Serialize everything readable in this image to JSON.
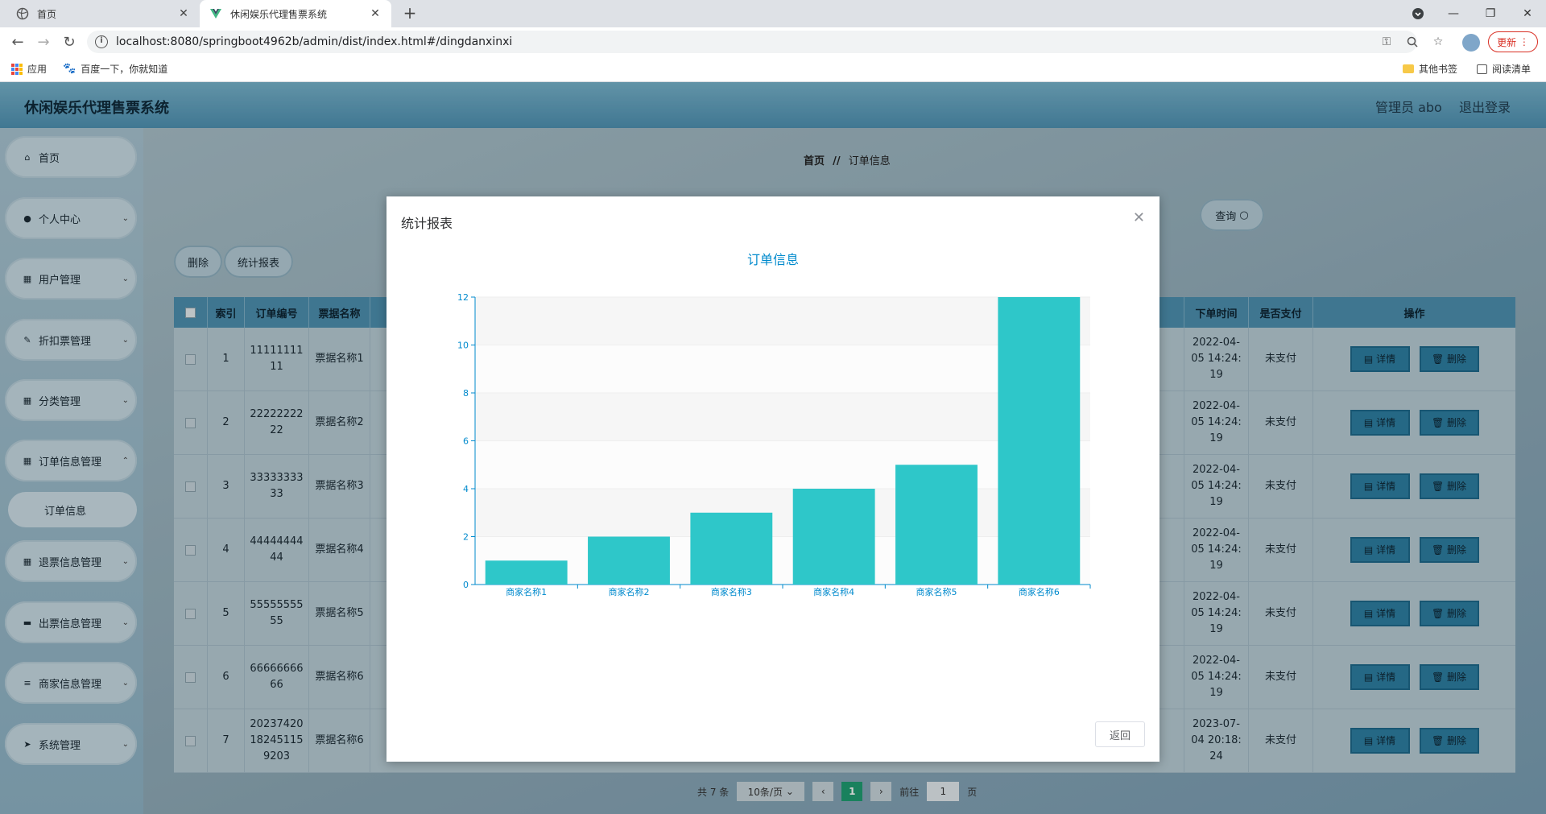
{
  "browser": {
    "tabs": [
      {
        "title": "首页",
        "active": false
      },
      {
        "title": "休闲娱乐代理售票系统",
        "active": true
      }
    ],
    "url": "localhost:8080/springboot4962b/admin/dist/index.html#/dingdanxinxi",
    "update_label": "更新",
    "bookmarks": {
      "apps": "应用",
      "baidu": "百度一下，你就知道",
      "other": "其他书签",
      "reading": "阅读清单"
    }
  },
  "header": {
    "title": "休闲娱乐代理售票系统",
    "user": "管理员 abo",
    "logout": "退出登录"
  },
  "sidebar": {
    "items": [
      {
        "label": "首页",
        "icon": "home-icon",
        "expandable": false
      },
      {
        "label": "个人中心",
        "icon": "user-icon",
        "expandable": true
      },
      {
        "label": "用户管理",
        "icon": "grid-icon",
        "expandable": true
      },
      {
        "label": "折扣票管理",
        "icon": "ticket-icon",
        "expandable": true
      },
      {
        "label": "分类管理",
        "icon": "grid-icon",
        "expandable": true
      },
      {
        "label": "订单信息管理",
        "icon": "grid-icon",
        "expandable": true
      },
      {
        "label": "退票信息管理",
        "icon": "grid-icon",
        "expandable": true
      },
      {
        "label": "出票信息管理",
        "icon": "briefcase-icon",
        "expandable": true
      },
      {
        "label": "商家信息管理",
        "icon": "menu-icon",
        "expandable": true
      },
      {
        "label": "系统管理",
        "icon": "send-icon",
        "expandable": true
      }
    ],
    "submenu": {
      "label": "订单信息"
    }
  },
  "main": {
    "breadcrumb": {
      "home": "首页",
      "sep": "//",
      "current": "订单信息"
    },
    "query_label": "查询",
    "delete_label": "删除",
    "report_label": "统计报表",
    "columns": {
      "index": "索引",
      "order_no": "订单编号",
      "ticket_name": "票据名称",
      "order_time": "下单时间",
      "paid": "是否支付",
      "ops": "操作"
    },
    "detail_label": "详情",
    "row_delete_label": "删除",
    "rows": [
      {
        "index": "1",
        "order_no": "1111111111",
        "ticket_name": "票据名称1",
        "time": "2022-04-05 14:24:19",
        "paid": "未支付"
      },
      {
        "index": "2",
        "order_no": "2222222222",
        "ticket_name": "票据名称2",
        "time": "2022-04-05 14:24:19",
        "paid": "未支付"
      },
      {
        "index": "3",
        "order_no": "3333333333",
        "ticket_name": "票据名称3",
        "time": "2022-04-05 14:24:19",
        "paid": "未支付"
      },
      {
        "index": "4",
        "order_no": "4444444444",
        "ticket_name": "票据名称4",
        "time": "2022-04-05 14:24:19",
        "paid": "未支付"
      },
      {
        "index": "5",
        "order_no": "5555555555",
        "ticket_name": "票据名称5",
        "time": "2022-04-05 14:24:19",
        "paid": "未支付"
      },
      {
        "index": "6",
        "order_no": "6666666666",
        "ticket_name": "票据名称6",
        "time": "2022-04-05 14:24:19",
        "paid": "未支付"
      },
      {
        "index": "7",
        "order_no": "20237420182451159203",
        "ticket_name": "票据名称6",
        "time": "2023-07-04 20:18:24",
        "paid": "未支付"
      }
    ],
    "pagination": {
      "total": "共 7 条",
      "page_size": "10条/页",
      "current_page": "1",
      "goto_prefix": "前往",
      "goto_value": "1",
      "goto_suffix": "页"
    }
  },
  "dialog": {
    "title": "统计报表",
    "return_label": "返回"
  },
  "chart_data": {
    "type": "bar",
    "title": "订单信息",
    "categories": [
      "商家名称1",
      "商家名称2",
      "商家名称3",
      "商家名称4",
      "商家名称5",
      "商家名称6"
    ],
    "values": [
      1,
      2,
      3,
      4,
      5,
      12
    ],
    "ylim": [
      0,
      12
    ],
    "yticks": [
      0,
      2,
      4,
      6,
      8,
      10,
      12
    ],
    "xlabel": "",
    "ylabel": "",
    "bar_color": "#2ec7c9",
    "axis_color": "#008acd"
  }
}
